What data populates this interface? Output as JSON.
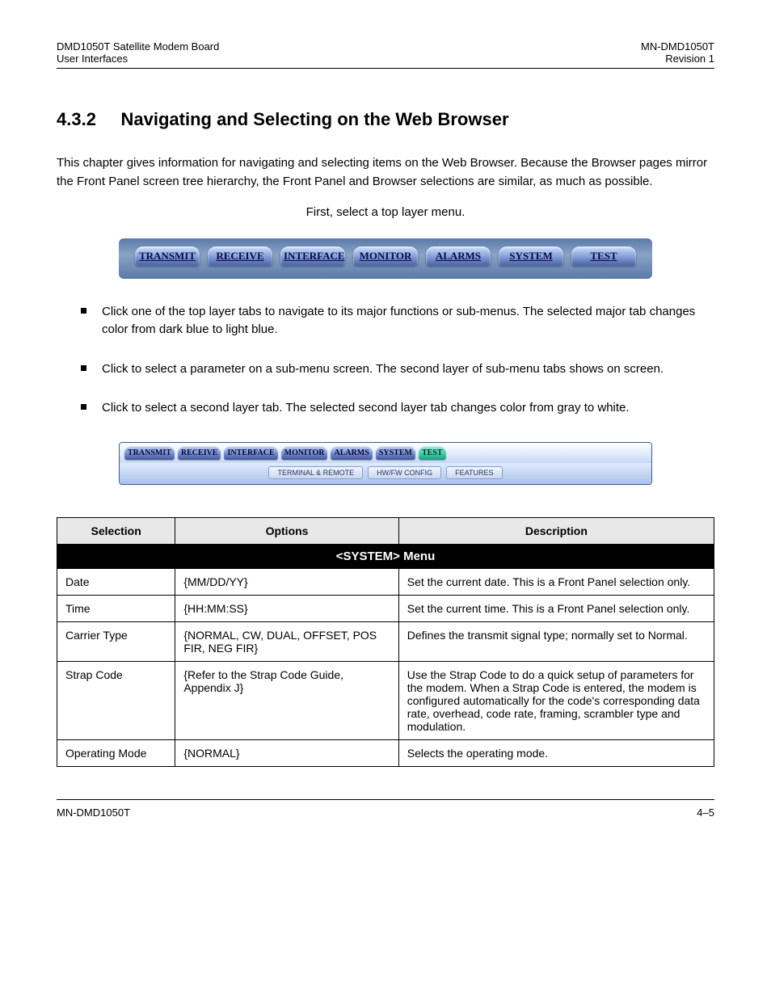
{
  "header": {
    "left_line1": "DMD1050T Satellite Modem Board",
    "left_line2": "User Interfaces",
    "right_line1": "MN-DMD1050T",
    "right_line2": "Revision 1"
  },
  "section": {
    "number": "4.3.2",
    "title": "Navigating and Selecting on the Web Browser",
    "intro": "This chapter gives information for navigating and selecting items on the Web Browser. Because the Browser pages mirror the Front Panel screen tree hierarchy, the Front Panel and Browser selections are similar, as much as possible.",
    "img1_caption": "First, select a top layer menu.",
    "bullets": [
      "Click one of the top layer tabs to navigate to its major functions or sub-menus. The selected major tab changes color from dark blue to light blue.",
      "Click to select a parameter on a sub-menu screen. The second layer of sub-menu tabs shows on screen.",
      "Click to select a second layer tab. The selected second layer tab changes color from gray to white."
    ]
  },
  "navbar1": {
    "items": [
      "TRANSMIT",
      "RECEIVE",
      "INTERFACE",
      "MONITOR",
      "ALARMS",
      "SYSTEM",
      "TEST"
    ]
  },
  "navbar2": {
    "primary": [
      {
        "label": "TRANSMIT",
        "active": false
      },
      {
        "label": "RECEIVE",
        "active": false
      },
      {
        "label": "INTERFACE",
        "active": false
      },
      {
        "label": "MONITOR",
        "active": false
      },
      {
        "label": "ALARMS",
        "active": false
      },
      {
        "label": "SYSTEM",
        "active": false
      },
      {
        "label": "TEST",
        "active": true
      }
    ],
    "secondary": [
      "TERMINAL & REMOTE",
      "HW/FW CONFIG",
      "FEATURES"
    ]
  },
  "table": {
    "title": "<SYSTEM> Menu",
    "headers": [
      "Selection",
      "Options",
      "Description"
    ],
    "rows": [
      {
        "sel": "Date",
        "opt": "{MM/DD/YY}",
        "desc": "Set the current date. This is a Front Panel selection only."
      },
      {
        "sel": "Time",
        "opt": "{HH:MM:SS}",
        "desc": "Set the current time. This is a Front Panel selection only."
      },
      {
        "sel": "Carrier Type",
        "opt": "{NORMAL, CW, DUAL, OFFSET, POS FIR, NEG FIR}",
        "desc": "Defines the transmit signal type; normally set to Normal."
      },
      {
        "sel": "Strap Code",
        "opt": "{Refer to the Strap Code Guide, Appendix J}",
        "desc": "Use the Strap Code to do a quick setup of parameters for the modem. When a Strap Code is entered, the modem is configured automatically for the code's corresponding data rate, overhead, code rate, framing, scrambler type and modulation."
      },
      {
        "sel": "Operating Mode",
        "opt": "{NORMAL}",
        "desc": "Selects the operating mode."
      }
    ]
  },
  "footer": {
    "left": "MN-DMD1050T",
    "right": "4–5"
  }
}
